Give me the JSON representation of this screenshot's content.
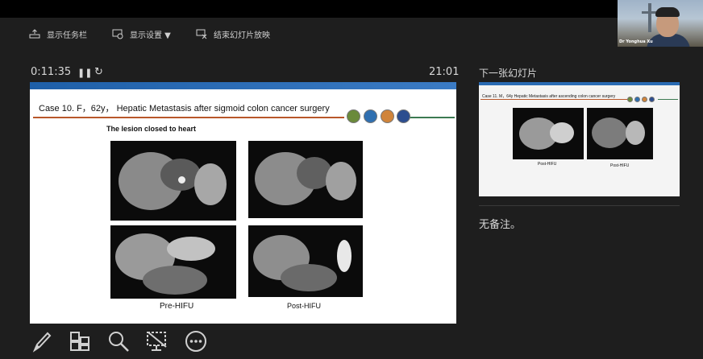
{
  "toolbar": {
    "taskbar_label": "显示任务栏",
    "display_settings_label": "显示设置 ▼",
    "end_show_label": "结束幻灯片放映"
  },
  "webcam": {
    "name": "Dr Yonghua Xu"
  },
  "presenter": {
    "elapsed": "0:11:35",
    "pause_icon": "pause-icon",
    "reset_icon": "reset-icon",
    "clock": "21:01",
    "next_slide_label": "下一张幻灯片",
    "notes": "无备注。"
  },
  "current_slide": {
    "title": "Case 10. F，62y， Hepatic Metastasis after sigmoid colon cancer surgery",
    "subtitle": "The lesion closed to heart",
    "caption_left": "Pre-HIFU",
    "caption_right": "Post-HIFU",
    "accent_colors": {
      "top_bar": "#1e5fa8",
      "rule": "#b8572a",
      "rule_end": "#3c7a52"
    }
  },
  "next_slide": {
    "title": "Case 11. M，64y Hepatic Metastasis after ascending colon cancer surgery",
    "caption_left": "Post-HIFU",
    "caption_right": "Post-HIFU"
  },
  "bottom_tools": [
    "pen-icon",
    "slides-grid-icon",
    "zoom-icon",
    "screen-black-icon",
    "more-options-icon"
  ]
}
